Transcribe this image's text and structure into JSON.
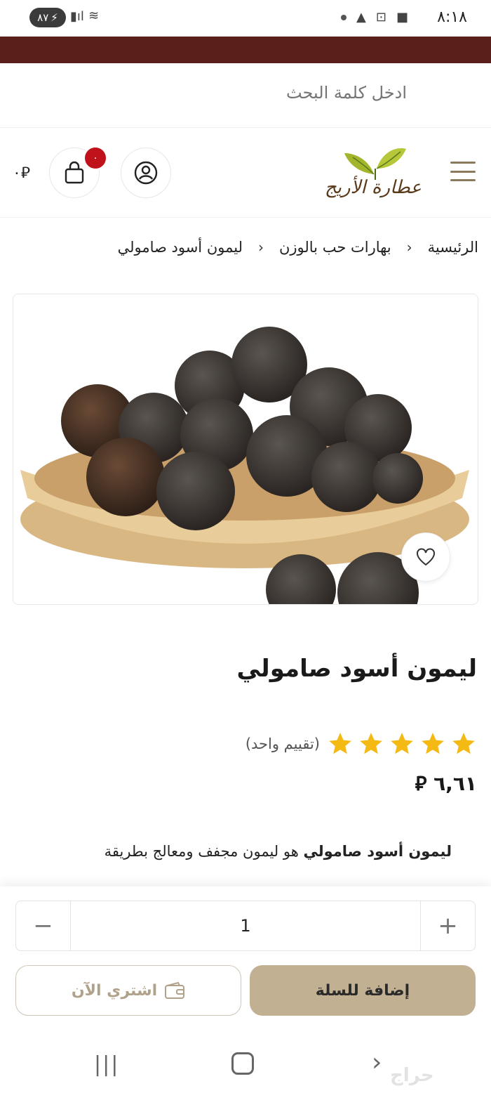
{
  "status_bar": {
    "time": "٨:١٨",
    "battery": "٨٧",
    "network": "5"
  },
  "search": {
    "placeholder": "ادخل كلمة البحث"
  },
  "header": {
    "logo_text": "عطارة الأريج",
    "cart_badge": "٠",
    "cart_total": "٠"
  },
  "breadcrumb": [
    "الرئيسية",
    "بهارات حب بالوزن",
    "ليمون أسود صامولي"
  ],
  "product": {
    "title": "ليمون أسود صامولي",
    "rating_stars": 5,
    "rating_text": "(تقييم واحد)",
    "price": "٦,٦١",
    "desc_bold": "ليمون أسود صامولي",
    "desc_rest": " هو ليمون مجفف ومعالج بطريقة"
  },
  "actions": {
    "quantity": "1",
    "buy_now_label": "اشتري الآن",
    "add_to_cart_label": "إضافة للسلة"
  },
  "watermark": "حراج",
  "colors": {
    "brand_dark": "#5a1f1a",
    "accent": "#c2b092",
    "star": "#f5b914",
    "badge": "#c0121b"
  }
}
